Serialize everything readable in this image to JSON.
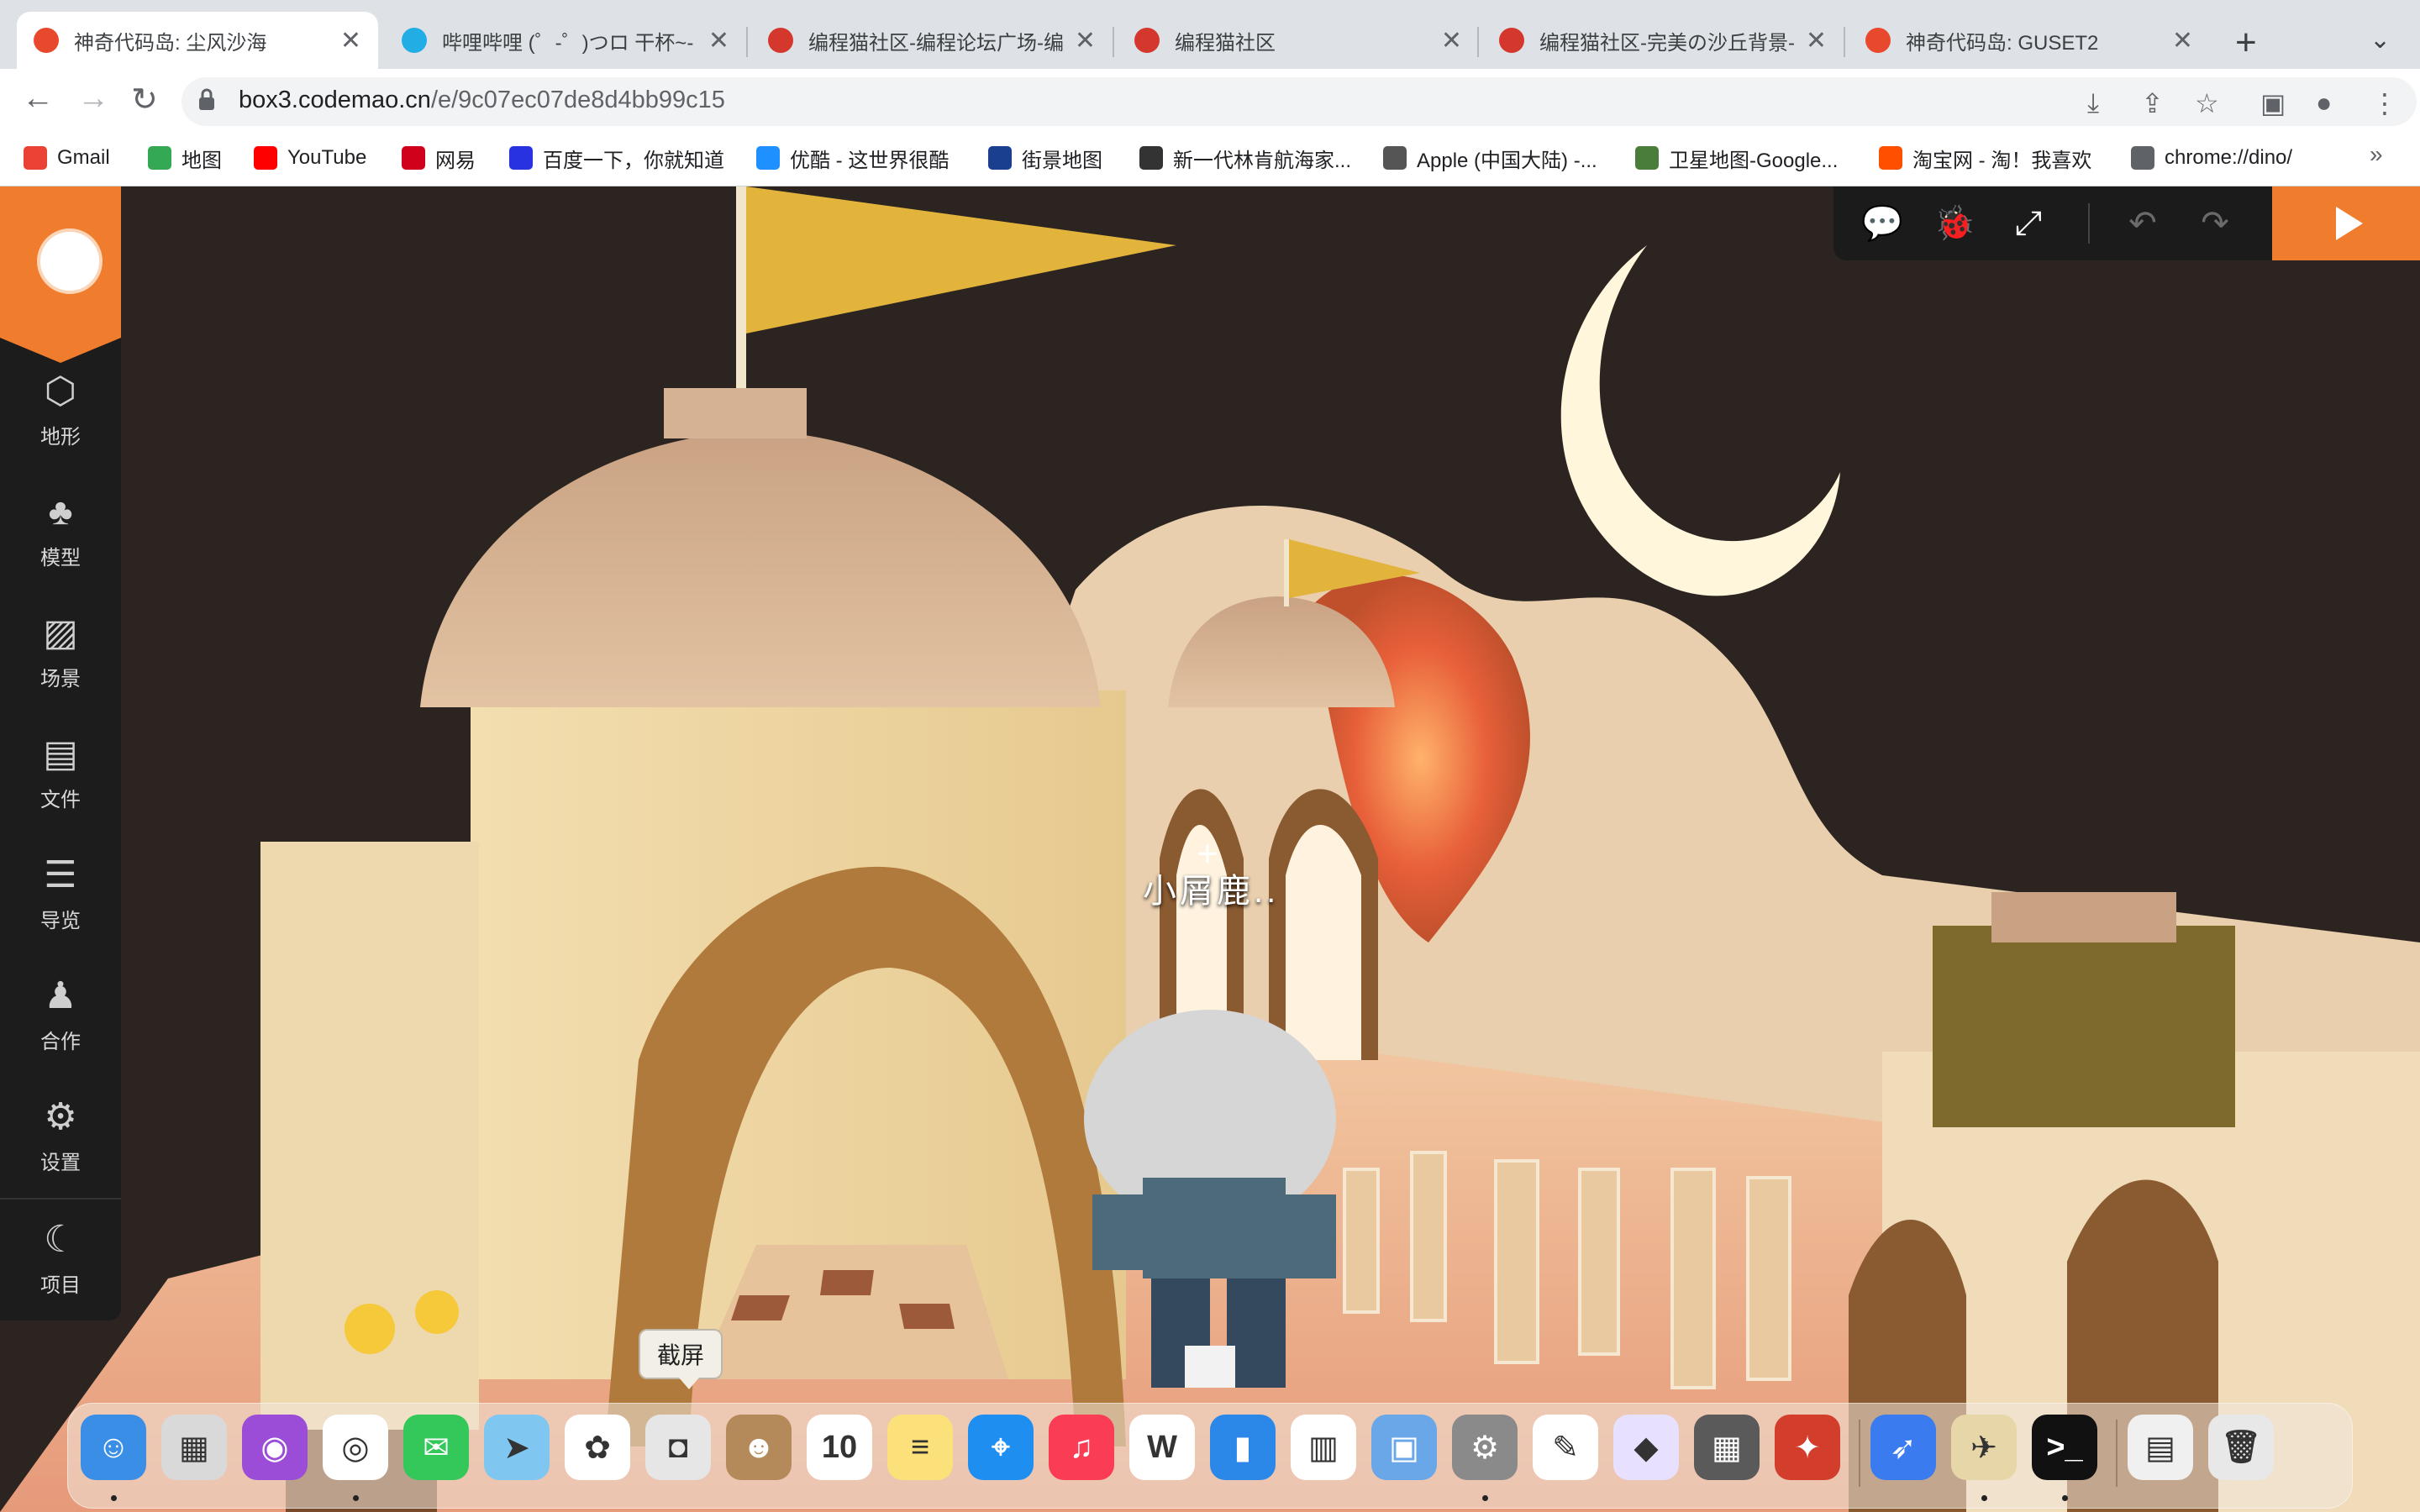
{
  "browser": {
    "tabs": [
      {
        "title": "神奇代码岛: 尘风沙海",
        "favicon_color": "#e8482c",
        "active": true
      },
      {
        "title": "哔哩哔哩 (゜-゜)つロ 干杯~-",
        "favicon_color": "#23ade5",
        "active": false
      },
      {
        "title": "编程猫社区-编程论坛广场-编",
        "favicon_color": "#d4372c",
        "active": false
      },
      {
        "title": "编程猫社区",
        "favicon_color": "#d4372c",
        "active": false
      },
      {
        "title": "编程猫社区-完美の沙丘背景-",
        "favicon_color": "#d4372c",
        "active": false
      },
      {
        "title": "神奇代码岛: GUSET2",
        "favicon_color": "#e8482c",
        "active": false
      }
    ],
    "tab_close": "✕",
    "new_tab": "+",
    "tab_menu": "⌄",
    "nav": {
      "back": "←",
      "forward": "→",
      "reload": "↻"
    },
    "url_host": "box3.codemao.cn",
    "url_path": "/e/9c07ec07de8d4bb99c15",
    "toolbar_icons": [
      "⤓",
      "⇪",
      "☆",
      "▣",
      "●",
      "⋮"
    ],
    "bookmarks": [
      {
        "label": "Gmail",
        "color": "#ea4335"
      },
      {
        "label": "地图",
        "color": "#34a853"
      },
      {
        "label": "YouTube",
        "color": "#ff0000"
      },
      {
        "label": "网易",
        "color": "#d0021b"
      },
      {
        "label": "百度一下，你就知道",
        "color": "#2932e1"
      },
      {
        "label": "优酷 - 这世界很酷",
        "color": "#1e90ff"
      },
      {
        "label": "街景地图",
        "color": "#1a3f8f"
      },
      {
        "label": "新一代林肯航海家...",
        "color": "#333333"
      },
      {
        "label": "Apple (中国大陆) -...",
        "color": "#555555"
      },
      {
        "label": "卫星地图-Google...",
        "color": "#4a7d3b"
      },
      {
        "label": "淘宝网 - 淘！我喜欢",
        "color": "#ff5000"
      },
      {
        "label": "chrome://dino/",
        "color": "#5f6368"
      }
    ],
    "bookmarks_more": "»"
  },
  "editor": {
    "sidebar": [
      {
        "label": "地形",
        "icon": "cube-icon",
        "glyph": "⬡"
      },
      {
        "label": "模型",
        "icon": "tree-icon",
        "glyph": "♣"
      },
      {
        "label": "场景",
        "icon": "image-icon",
        "glyph": "▨"
      },
      {
        "label": "文件",
        "icon": "folder-icon",
        "glyph": "▤"
      },
      {
        "label": "导览",
        "icon": "list-icon",
        "glyph": "☰"
      },
      {
        "label": "合作",
        "icon": "people-icon",
        "glyph": "♟"
      },
      {
        "label": "设置",
        "icon": "gear-icon",
        "glyph": "⚙"
      }
    ],
    "project": {
      "label": "项目",
      "icon": "moon-icon",
      "glyph": "☾"
    },
    "topbar": {
      "comment": "💬",
      "debug": "🐞",
      "fullscreen": "⤢",
      "undo": "↶",
      "redo": "↷"
    },
    "player_name": "小屑鹿..",
    "crosshair": "+",
    "tooltip": "截屏"
  },
  "dock": {
    "apps": [
      {
        "name": "finder",
        "color": "#3a8ee6",
        "glyph": "☺"
      },
      {
        "name": "launchpad",
        "color": "#d9d9d9",
        "glyph": "▦"
      },
      {
        "name": "podcasts",
        "color": "#9b4dd8",
        "glyph": "◉"
      },
      {
        "name": "chrome",
        "color": "#ffffff",
        "glyph": "◎"
      },
      {
        "name": "messages",
        "color": "#34c759",
        "glyph": "✉"
      },
      {
        "name": "maps",
        "color": "#7fc6f0",
        "glyph": "➤"
      },
      {
        "name": "photos",
        "color": "#ffffff",
        "glyph": "✿"
      },
      {
        "name": "screenshot",
        "color": "#e6e6e6",
        "glyph": "◘"
      },
      {
        "name": "contacts",
        "color": "#b48a5a",
        "glyph": "☻"
      },
      {
        "name": "calendar",
        "color": "#ffffff",
        "glyph": "10"
      },
      {
        "name": "notes",
        "color": "#fce17a",
        "glyph": "≡"
      },
      {
        "name": "safari",
        "color": "#1f8ef1",
        "glyph": "⌖"
      },
      {
        "name": "music",
        "color": "#fa3c55",
        "glyph": "♫"
      },
      {
        "name": "wps",
        "color": "#ffffff",
        "glyph": "W"
      },
      {
        "name": "keynote",
        "color": "#2b88e8",
        "glyph": "▮"
      },
      {
        "name": "numbers",
        "color": "#ffffff",
        "glyph": "▥"
      },
      {
        "name": "preview",
        "color": "#6aa7e8",
        "glyph": "▣"
      },
      {
        "name": "system-preferences",
        "color": "#8a8a8a",
        "glyph": "⚙"
      },
      {
        "name": "pages",
        "color": "#ffffff",
        "glyph": "✎"
      },
      {
        "name": "sketch",
        "color": "#e8e0ff",
        "glyph": "◆"
      },
      {
        "name": "calculator",
        "color": "#5a5a5a",
        "glyph": "▦"
      },
      {
        "name": "instruments",
        "color": "#d23d2c",
        "glyph": "✦"
      },
      {
        "name": "feishu",
        "color": "#3a7bf0",
        "glyph": "➶"
      },
      {
        "name": "python",
        "color": "#e7d6a7",
        "glyph": "✈"
      },
      {
        "name": "terminal",
        "color": "#111111",
        "glyph": ">_"
      },
      {
        "name": "screen-capture-stack",
        "color": "#f0f0f0",
        "glyph": "▤"
      },
      {
        "name": "trash",
        "color": "#e8e8e8",
        "glyph": "🗑"
      }
    ]
  }
}
